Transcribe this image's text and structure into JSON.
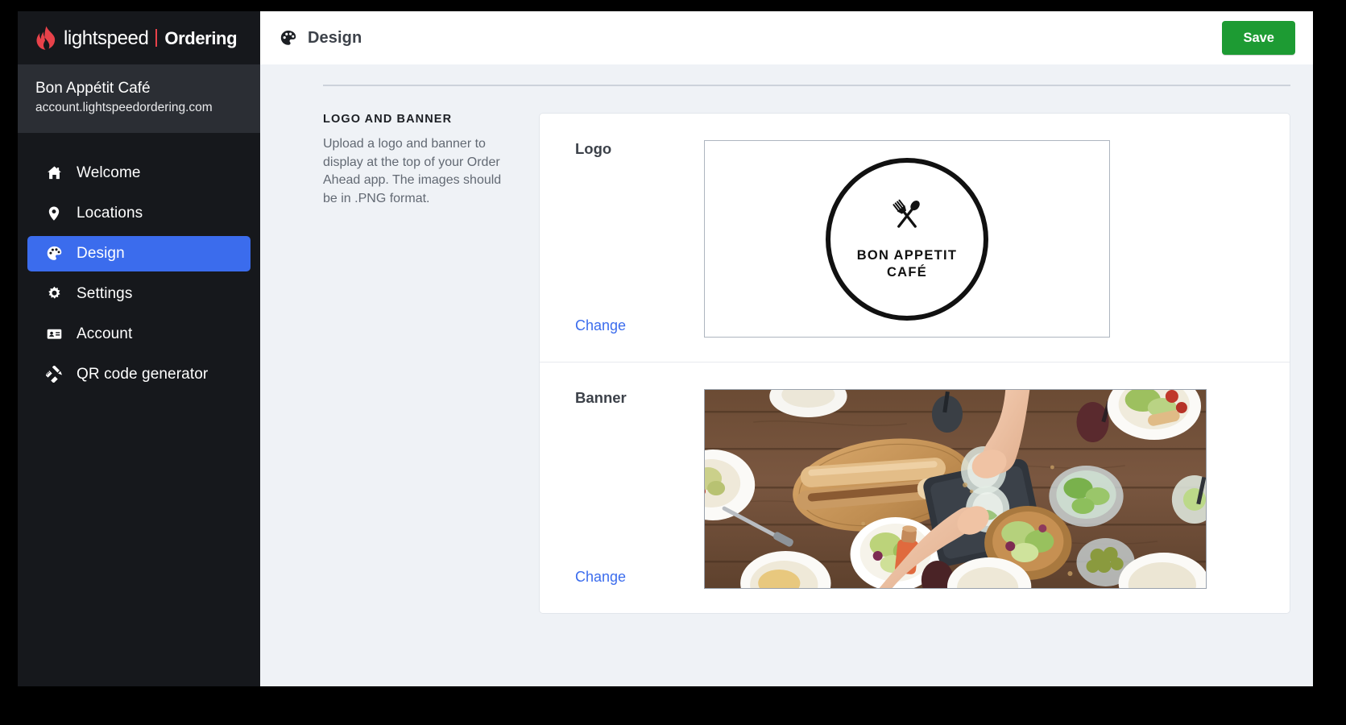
{
  "brand": {
    "name": "lightspeed",
    "product": "Ordering",
    "flame_color": "#e8424a"
  },
  "account": {
    "name": "Bon Appétit Café",
    "domain": "account.lightspeedordering.com"
  },
  "sidebar": {
    "items": [
      {
        "label": "Welcome",
        "icon": "home-icon",
        "active": false
      },
      {
        "label": "Locations",
        "icon": "map-pin-icon",
        "active": false
      },
      {
        "label": "Design",
        "icon": "palette-icon",
        "active": true
      },
      {
        "label": "Settings",
        "icon": "gear-icon",
        "active": false
      },
      {
        "label": "Account",
        "icon": "id-card-icon",
        "active": false
      },
      {
        "label": "QR code generator",
        "icon": "ruler-pencil-icon",
        "active": false
      }
    ],
    "active_color": "#3b6ced",
    "background": "#16181c"
  },
  "topbar": {
    "icon": "palette-icon",
    "title": "Design",
    "save_label": "Save",
    "save_color": "#1d9b33"
  },
  "section": {
    "kicker": "LOGO AND BANNER",
    "description": "Upload a logo and banner to display at the top of your Order Ahead app. The images should be in .PNG format."
  },
  "logo_row": {
    "label": "Logo",
    "change_label": "Change",
    "preview": {
      "type": "logo-image",
      "text_line_1": "BON APPETIT",
      "text_line_2": "CAFÉ",
      "emblem": "crossed-spoon-fork-in-circle"
    }
  },
  "banner_row": {
    "label": "Banner",
    "change_label": "Change",
    "preview": {
      "type": "banner-photo",
      "description": "Overhead photo of a wooden table with baguettes on a cutting board, salads, olives and hands reaching for glasses"
    }
  }
}
